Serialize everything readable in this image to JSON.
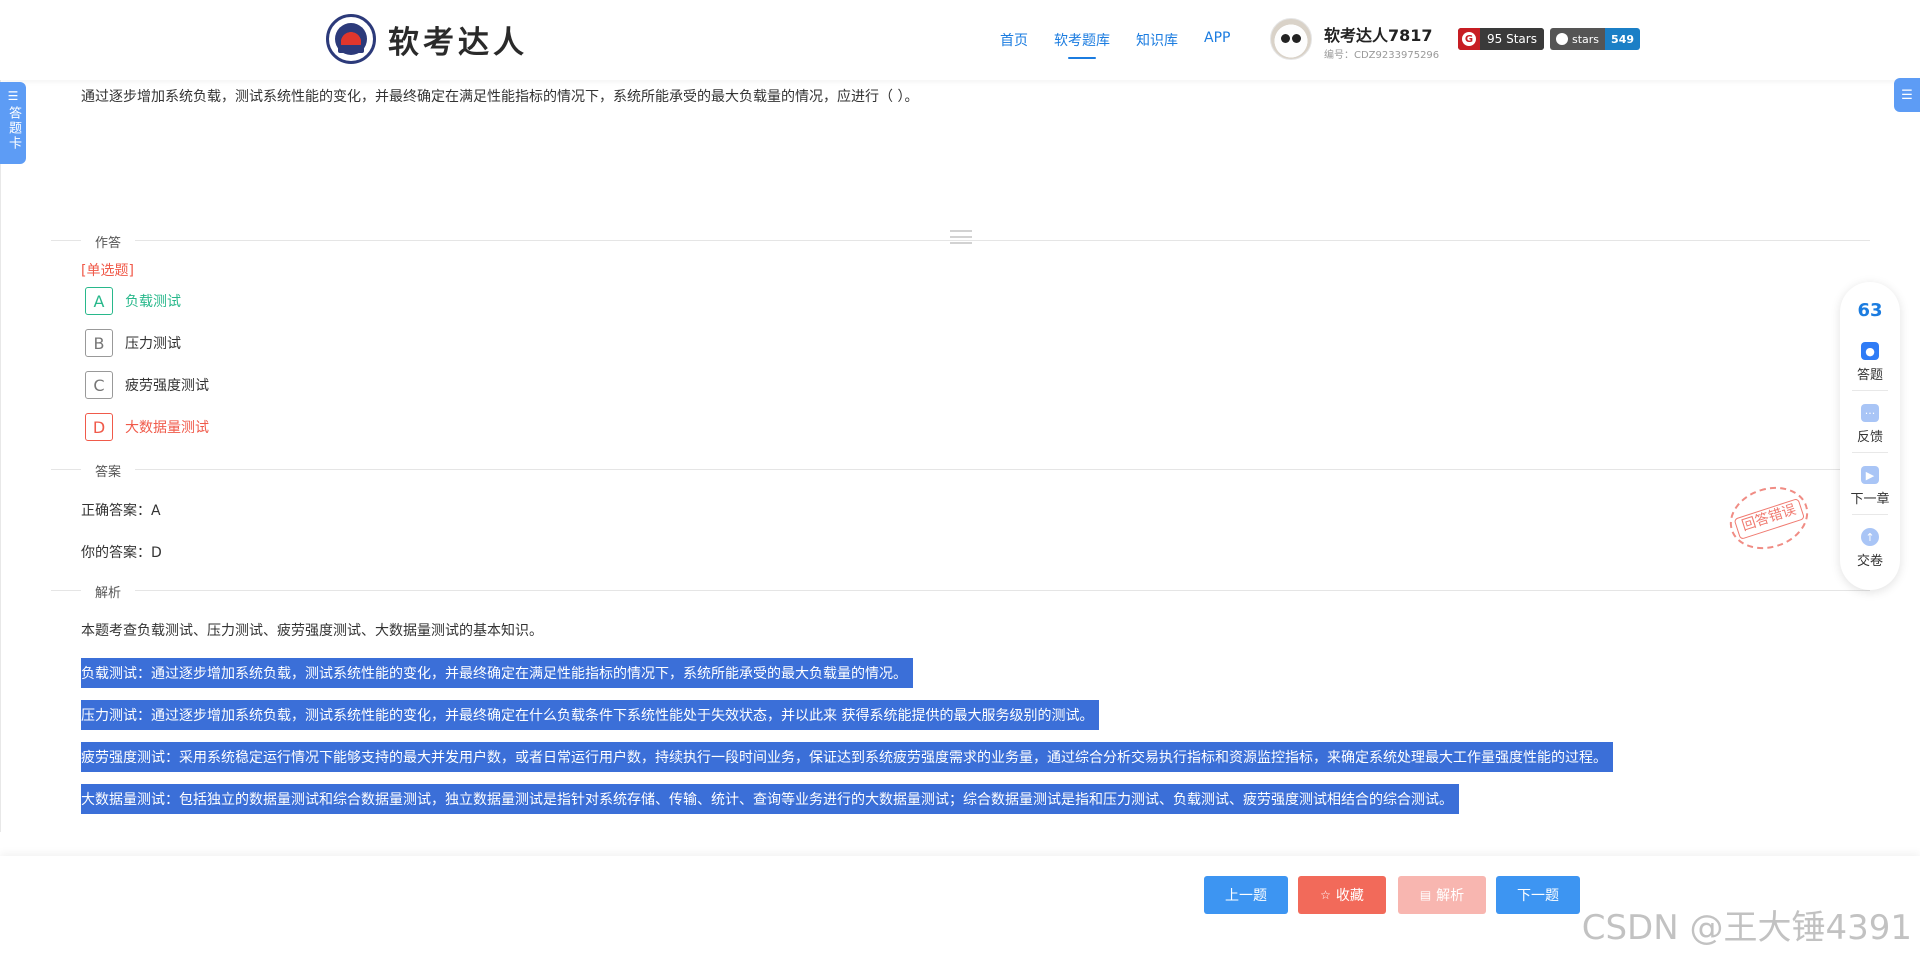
{
  "header": {
    "brand": "软考达人",
    "nav": [
      {
        "label": "首页"
      },
      {
        "label": "软考题库"
      },
      {
        "label": "知识库"
      },
      {
        "label": "APP"
      }
    ],
    "user_name": "软考达人7817",
    "user_id": "编号：CDZ9233975296",
    "gitee_badge": "95 Stars",
    "github_badge_label": "stars",
    "github_badge_count": "549"
  },
  "side": {
    "left_tab": "答题卡"
  },
  "question": {
    "text": "通过逐步增加系统负载，测试系统性能的变化，并最终确定在满足性能指标的情况下，系统所能承受的最大负载量的情况，应进行（ ）。",
    "type": "[单选题]",
    "options": [
      {
        "letter": "A",
        "text": "负载测试",
        "state": "correct"
      },
      {
        "letter": "B",
        "text": "压力测试",
        "state": "normal"
      },
      {
        "letter": "C",
        "text": "疲劳强度测试",
        "state": "normal"
      },
      {
        "letter": "D",
        "text": "大数据量测试",
        "state": "wrong"
      }
    ]
  },
  "sections": {
    "answer_section": "作答",
    "key_section": "答案",
    "analysis_section": "解析"
  },
  "answer": {
    "correct": "正确答案：A",
    "yours": "你的答案：D",
    "stamp": "回答错误"
  },
  "analysis": {
    "intro": "本题考查负载测试、压力测试、疲劳强度测试、大数据量测试的基本知识。",
    "lines": [
      "负载测试：通过逐步增加系统负载，测试系统性能的变化，并最终确定在满足性能指标的情况下，系统所能承受的最大负载量的情况。",
      "压力测试：通过逐步增加系统负载，测试系统性能的变化，并最终确定在什么负载条件下系统性能处于失效状态，并以此来 获得系统能提供的最大服务级别的测试。",
      "疲劳强度测试：采用系统稳定运行情况下能够支持的最大并发用户数，或者日常运行用户数，持续执行一段时间业务，保证达到系统疲劳强度需求的业务量，通过综合分析交易执行指标和资源监控指标，来确定系统处理最大工作量强度性能的过程。",
      "大数据量测试：包括独立的数据量测试和综合数据量测试，独立数据量测试是指针对系统存储、传输、统计、查询等业务进行的大数据量测试；综合数据量测试是指和压力测试、负载测试、疲劳强度测试相结合的综合测试。"
    ]
  },
  "toolbar": {
    "count": "63",
    "items": [
      "答题",
      "反馈",
      "下一章",
      "交卷"
    ]
  },
  "footer": {
    "prev": "上一题",
    "favorite": "收藏",
    "analysis": "解析",
    "next": "下一题"
  },
  "watermark": "CSDN @王大锤4391",
  "colors": {
    "accent": "#1b7ce0",
    "correct": "#28b88b",
    "wrong": "#f05a4a",
    "highlight": "#3b6fd8"
  }
}
